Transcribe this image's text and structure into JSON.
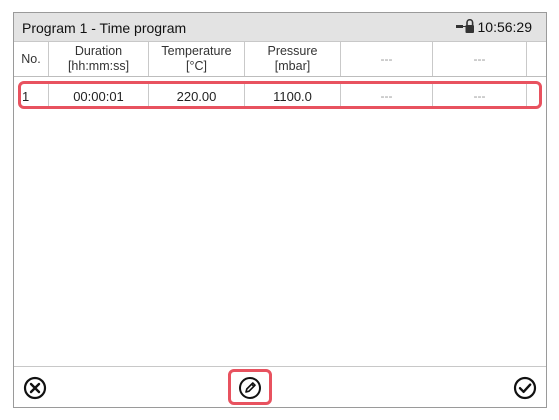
{
  "header": {
    "title": "Program 1 - Time program",
    "time": "10:56:29",
    "status_icon": "lock-icon"
  },
  "table": {
    "columns": [
      {
        "line1": "No.",
        "line2": ""
      },
      {
        "line1": "Duration",
        "line2": "[hh:mm:ss]"
      },
      {
        "line1": "Temperature",
        "line2": "[°C]"
      },
      {
        "line1": "Pressure",
        "line2": "[mbar]"
      },
      {
        "line1": "---",
        "line2": ""
      },
      {
        "line1": "---",
        "line2": ""
      }
    ],
    "rows": [
      [
        "1",
        "00:00:01",
        "220.00",
        "1100.0",
        "---",
        "---"
      ]
    ]
  },
  "toolbar": {
    "cancel_icon": "cancel-circle-icon",
    "edit_icon": "edit-pencil-icon",
    "ok_icon": "confirm-check-icon"
  },
  "colors": {
    "highlight": "#e8525f",
    "titlebar": "#e3e3e3"
  }
}
